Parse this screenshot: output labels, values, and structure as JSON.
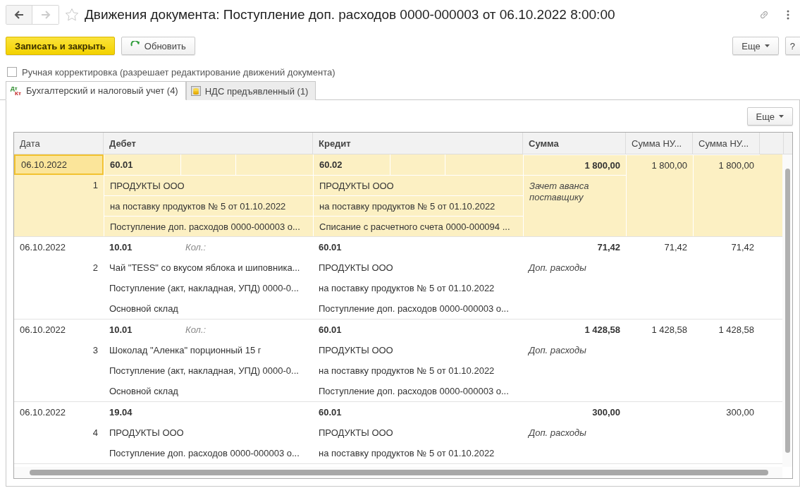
{
  "window": {
    "title": "Движения документа: Поступление доп. расходов 0000-000003 от 06.10.2022 8:00:00",
    "favorite": false
  },
  "toolbar": {
    "primary": "Записать и закрыть",
    "refresh": "Обновить",
    "more": "Еще",
    "help": "?"
  },
  "manual_edit": {
    "label": "Ручная корректировка (разрешает редактирование движений документа)",
    "checked": false
  },
  "tabs": [
    {
      "label": "Бухгалтерский и налоговый учет (4)",
      "selected": true,
      "kind": "dtkt",
      "icon_top": "Дт",
      "icon_bottom": "Кт"
    },
    {
      "label": "НДС предъявленный (1)",
      "selected": false,
      "kind": "coins"
    }
  ],
  "table_more": "Еще",
  "table": {
    "columns": [
      {
        "label": "Дата",
        "emphasized": false
      },
      {
        "label": "Дебет",
        "emphasized": true
      },
      {
        "label": "Кредит",
        "emphasized": true
      },
      {
        "label": "Сумма",
        "emphasized": true
      },
      {
        "label": "Сумма НУ...",
        "emphasized": false
      },
      {
        "label": "Сумма НУ...",
        "emphasized": false
      }
    ],
    "rows": [
      {
        "date": "06.10.2022",
        "number": "1",
        "selected": true,
        "debit": {
          "account": "60.01",
          "lines": [
            "ПРОДУКТЫ ООО",
            "на поставку продуктов № 5 от 01.10.2022",
            "Поступление доп. расходов 0000-000003 о..."
          ]
        },
        "credit": {
          "account": "60.02",
          "lines": [
            "ПРОДУКТЫ ООО",
            "на поставку продуктов № 5 от 01.10.2022",
            "Списание с расчетного счета 0000-000094 ..."
          ]
        },
        "sum": "1 800,00",
        "note": "Зачет аванса поставщику",
        "sum_nu": "1 800,00",
        "sum_nu_2": "1 800,00"
      },
      {
        "date": "06.10.2022",
        "number": "2",
        "selected": false,
        "debit": {
          "account": "10.01",
          "qty_label": "Кол.:",
          "lines": [
            "Чай \"TESS\" со вкусом яблока и шиповника...",
            "Поступление (акт, накладная, УПД) 0000-0...",
            "Основной склад"
          ]
        },
        "credit": {
          "account": "60.01",
          "lines": [
            "ПРОДУКТЫ ООО",
            "на поставку продуктов № 5 от 01.10.2022",
            "Поступление доп. расходов 0000-000003 о..."
          ]
        },
        "sum": "71,42",
        "note": "Доп. расходы",
        "sum_nu": "71,42",
        "sum_nu_2": "71,42"
      },
      {
        "date": "06.10.2022",
        "number": "3",
        "selected": false,
        "debit": {
          "account": "10.01",
          "qty_label": "Кол.:",
          "lines": [
            "Шоколад \"Аленка\" порционный 15 г",
            "Поступление (акт, накладная, УПД) 0000-0...",
            "Основной склад"
          ]
        },
        "credit": {
          "account": "60.01",
          "lines": [
            "ПРОДУКТЫ ООО",
            "на поставку продуктов № 5 от 01.10.2022",
            "Поступление доп. расходов 0000-000003 о..."
          ]
        },
        "sum": "1 428,58",
        "note": "Доп. расходы",
        "sum_nu": "1 428,58",
        "sum_nu_2": "1 428,58"
      },
      {
        "date": "06.10.2022",
        "number": "4",
        "selected": false,
        "debit": {
          "account": "19.04",
          "lines": [
            "ПРОДУКТЫ ООО",
            "Поступление доп. расходов 0000-000003 о..."
          ]
        },
        "credit": {
          "account": "60.01",
          "lines": [
            "ПРОДУКТЫ ООО",
            "на поставку продуктов № 5 от 01.10.2022"
          ]
        },
        "sum": "300,00",
        "note": "Доп. расходы",
        "sum_nu_2": "300,00"
      }
    ]
  }
}
